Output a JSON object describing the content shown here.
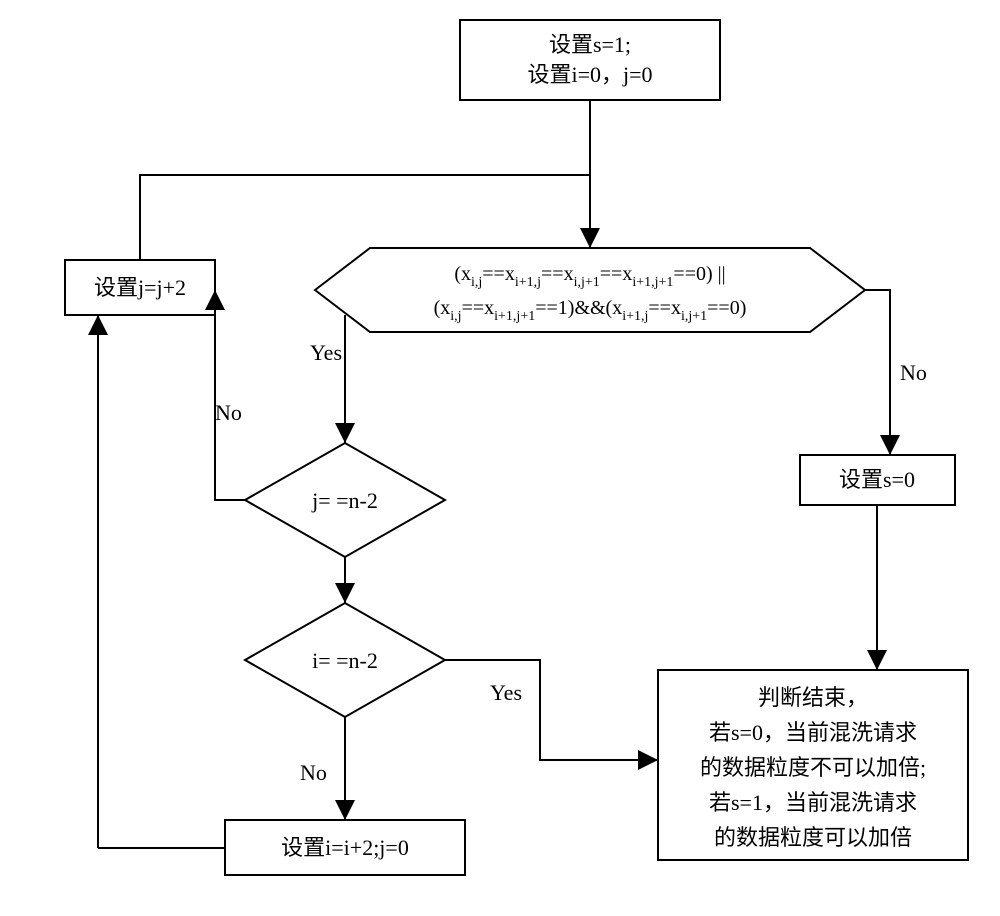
{
  "init": {
    "line1": "设置s=1;",
    "line2": "设置i=0，j=0"
  },
  "cond_main": {
    "line1_parts": [
      "(x",
      "i,j",
      "==x",
      "i+1,j",
      "==x",
      "i,j+1",
      "==x",
      "i+1,j+1",
      "==0) ||"
    ],
    "line2_parts": [
      "(x",
      "i,j",
      "==x",
      "i+1,j+1",
      "==1)&&(x",
      "i+1,j",
      "==x",
      "i,j+1",
      "==0)"
    ]
  },
  "set_j": "设置j=j+2",
  "cond_j": "j= =n-2",
  "cond_i": "i= =n-2",
  "set_i": "设置i=i+2;j=0",
  "set_s0": "设置s=0",
  "final": {
    "l1": "判断结束，",
    "l2": "若s=0，当前混洗请求",
    "l3": "的数据粒度不可以加倍;",
    "l4": "若s=1，当前混洗请求",
    "l5": "的数据粒度可以加倍"
  },
  "labels": {
    "yes": "Yes",
    "no": "No"
  }
}
